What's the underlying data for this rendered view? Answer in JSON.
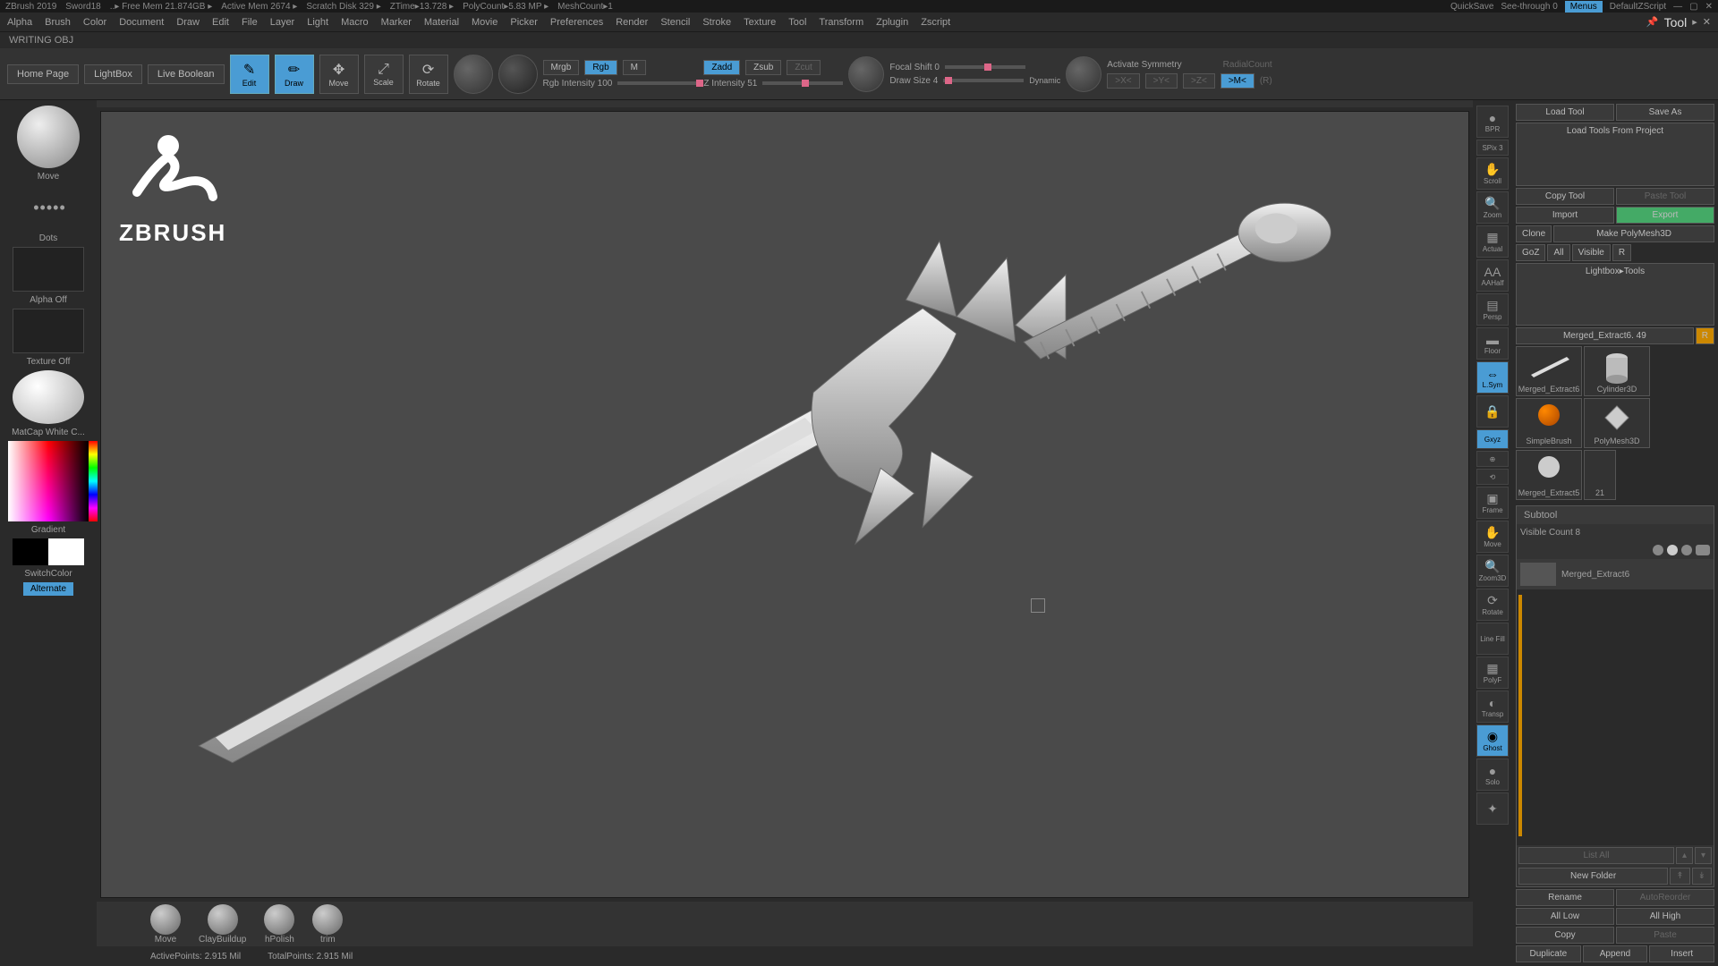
{
  "titlebar": {
    "app": "ZBrush 2019",
    "file": "Sword18",
    "freeMem": "..▸ Free Mem 21.874GB ▸",
    "activeMem": "Active Mem 2674 ▸",
    "scratch": "Scratch Disk 329 ▸",
    "ztime": "ZTime▸13.728 ▸",
    "poly": "PolyCount▸5.83 MP ▸",
    "mesh": "MeshCount▸1",
    "quicksave": "QuickSave",
    "seethrough": "See-through  0",
    "menus": "Menus",
    "zscript": "DefaultZScript"
  },
  "menu": [
    "Alpha",
    "Brush",
    "Color",
    "Document",
    "Draw",
    "Edit",
    "File",
    "Layer",
    "Light",
    "Macro",
    "Marker",
    "Material",
    "Movie",
    "Picker",
    "Preferences",
    "Render",
    "Stencil",
    "Stroke",
    "Texture",
    "Tool",
    "Transform",
    "Zplugin",
    "Zscript"
  ],
  "status": "WRITING OBJ",
  "toolbar": {
    "home": "Home Page",
    "lightbox": "LightBox",
    "liveBoolean": "Live Boolean",
    "edit": "Edit",
    "draw": "Draw",
    "move": "Move",
    "scale": "Scale",
    "rotate": "Rotate",
    "mrgb": "Mrgb",
    "rgb": "Rgb",
    "m": "M",
    "rgbIntensity": "Rgb Intensity 100",
    "zadd": "Zadd",
    "zsub": "Zsub",
    "zcut": "Zcut",
    "zIntensity": "Z Intensity 51",
    "focalShift": "Focal Shift 0",
    "drawSize": "Draw Size 4",
    "dynamic": "Dynamic",
    "activateSymmetry": "Activate Symmetry",
    "radialCount": "RadialCount",
    "xsym": ">X<",
    "ysym": ">Y<",
    "zsym": ">Z<",
    "msym": ">M<",
    "rsym": "(R)"
  },
  "left": {
    "move": "Move",
    "dots": "Dots",
    "alphaOff": "Alpha Off",
    "textureOff": "Texture Off",
    "matcap": "MatCap White C...",
    "gradient": "Gradient",
    "switchColor": "SwitchColor",
    "alternate": "Alternate"
  },
  "logo": "ZBRUSH",
  "rightIcons": {
    "bpr": "BPR",
    "spix": "SPix 3",
    "scroll": "Scroll",
    "zoom": "Zoom",
    "actual": "Actual",
    "aahalf": "AAHalf",
    "persp": "Persp",
    "floor": "Floor",
    "lsym": "L.Sym",
    "lock": "",
    "axes": "Gxyz",
    "frame": "Frame",
    "moveR": "Move",
    "zoom3d": "Zoom3D",
    "rotateR": "Rotate",
    "lineFill": "Line Fill",
    "polyf": "PolyF",
    "transp": "Transp",
    "ghost": "Ghost",
    "solo": "Solo",
    "xpose": "Xpose"
  },
  "right": {
    "title": "Tool",
    "loadTool": "Load Tool",
    "saveAs": "Save As",
    "loadProject": "Load Tools From Project",
    "copyTool": "Copy Tool",
    "pasteTool": "Paste Tool",
    "import": "Import",
    "export": "Export",
    "clone": "Clone",
    "makePoly": "Make PolyMesh3D",
    "goz": "GoZ",
    "all": "All",
    "visible": "Visible",
    "r": "R",
    "lightboxTools": "Lightbox▸Tools",
    "currentTool": "Merged_Extract6. 49",
    "tools": [
      "Merged_Extract6",
      "Cylinder3D",
      "SimpleBrush",
      "PolyMesh3D",
      "Merged_Extract5",
      "21",
      "Merged_Extract6"
    ],
    "subtool": "Subtool",
    "visibleCount": "Visible Count 8",
    "subtoolItem": "Merged_Extract6",
    "listAll": "List All",
    "newFolder": "New Folder",
    "rename": "Rename",
    "autoReorder": "AutoReorder",
    "allLow": "All Low",
    "allHigh": "All High",
    "copy": "Copy",
    "paste": "Paste",
    "duplicate": "Duplicate",
    "append": "Append",
    "insert": "Insert"
  },
  "brushes": [
    "Move",
    "ClayBuildup",
    "hPolish",
    "trim"
  ],
  "footerStatus": {
    "active": "ActivePoints: 2.915 Mil",
    "total": "TotalPoints: 2.915 Mil"
  }
}
